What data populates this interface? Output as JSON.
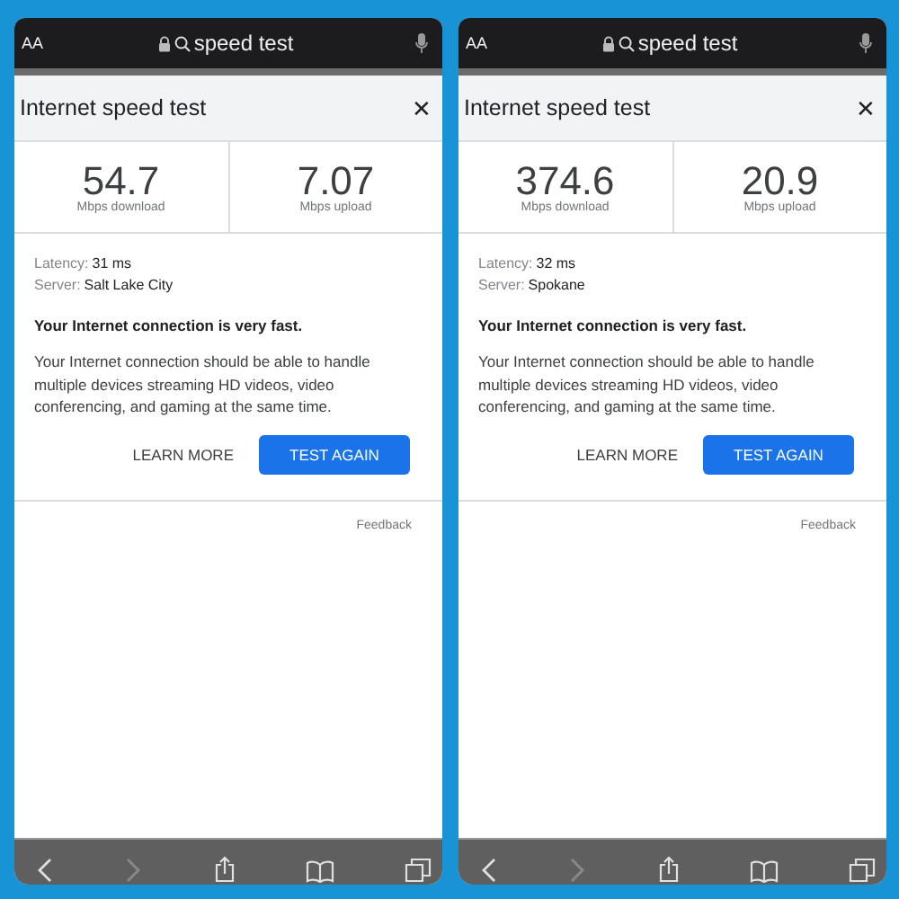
{
  "phones": [
    {
      "address_bar": {
        "text_size": "AA",
        "query": "speed test"
      },
      "panel": {
        "title": "Internet speed test",
        "close": "✕",
        "metrics": [
          {
            "value": "54.7",
            "unit": "Mbps download"
          },
          {
            "value": "7.07",
            "unit": "Mbps upload"
          }
        ],
        "latency_label": "Latency:",
        "latency": "31 ms",
        "server_label": "Server:",
        "server": "Salt Lake City",
        "verdict": "Your Internet connection is very fast.",
        "description": "Your Internet connection should be able to handle multiple devices streaming HD videos, video conferencing, and gaming at the same time.",
        "buttons": [
          {
            "label": "LEARN MORE",
            "kind": "text"
          },
          {
            "label": "TEST AGAIN",
            "kind": "filled"
          }
        ],
        "feedback": "Feedback"
      },
      "toolbar": [
        {
          "kind": "back",
          "disabled": false
        },
        {
          "kind": "forward",
          "disabled": true
        },
        {
          "kind": "share",
          "disabled": false
        },
        {
          "kind": "bookmarks",
          "disabled": false
        },
        {
          "kind": "tabs",
          "disabled": false
        }
      ]
    },
    {
      "address_bar": {
        "text_size": "AA",
        "query": "speed test"
      },
      "panel": {
        "title": "Internet speed test",
        "close": "✕",
        "metrics": [
          {
            "value": "374.6",
            "unit": "Mbps download"
          },
          {
            "value": "20.9",
            "unit": "Mbps upload"
          }
        ],
        "latency_label": "Latency:",
        "latency": "32 ms",
        "server_label": "Server:",
        "server": "Spokane",
        "verdict": "Your Internet connection is very fast.",
        "description": "Your Internet connection should be able to handle multiple devices streaming HD videos, video conferencing, and gaming at the same time.",
        "buttons": [
          {
            "label": "LEARN MORE",
            "kind": "text"
          },
          {
            "label": "TEST AGAIN",
            "kind": "filled"
          }
        ],
        "feedback": "Feedback"
      },
      "toolbar": [
        {
          "kind": "back",
          "disabled": false
        },
        {
          "kind": "forward",
          "disabled": true
        },
        {
          "kind": "share",
          "disabled": false
        },
        {
          "kind": "bookmarks",
          "disabled": false
        },
        {
          "kind": "tabs",
          "disabled": false
        }
      ]
    }
  ]
}
